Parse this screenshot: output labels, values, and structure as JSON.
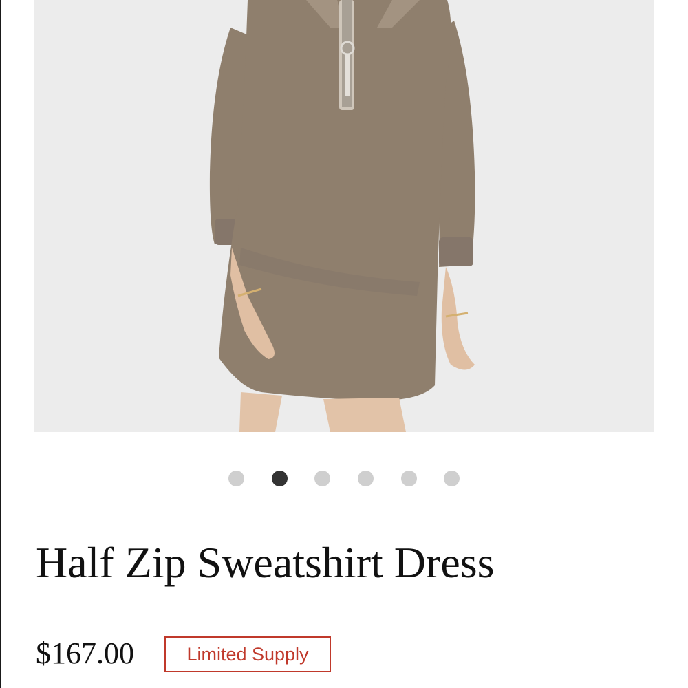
{
  "product": {
    "title": "Half Zip Sweatshirt Dress",
    "price": "$167.00",
    "badge": "Limited Supply",
    "image_alt": "model wearing taupe half zip sweatshirt dress"
  },
  "carousel": {
    "count": 6,
    "active_index": 1
  },
  "colors": {
    "dress": "#8f7f6d",
    "badge": "#c0392b",
    "dot_active": "#333333",
    "dot_inactive": "#cfcfcf"
  }
}
